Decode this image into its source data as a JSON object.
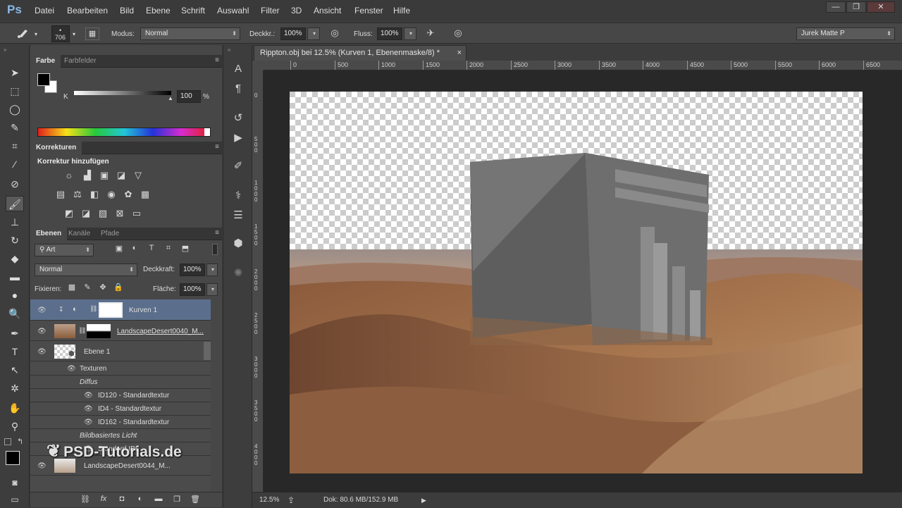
{
  "app": {
    "logo": "Ps"
  },
  "menu": [
    "Datei",
    "Bearbeiten",
    "Bild",
    "Ebene",
    "Schrift",
    "Auswahl",
    "Filter",
    "3D",
    "Ansicht",
    "Fenster",
    "Hilfe"
  ],
  "window_controls": {
    "minimize": "—",
    "restore": "❐",
    "close": "✕"
  },
  "options": {
    "brush_size": "706",
    "mode_label": "Modus:",
    "mode_value": "Normal",
    "opacity_label": "Deckkr.:",
    "opacity_value": "100%",
    "flow_label": "Fluss:",
    "flow_value": "100%",
    "workspace": "Jurek Matte P"
  },
  "tools": [
    "move-tool",
    "marquee-tool",
    "lasso-tool",
    "quick-select-tool",
    "crop-tool",
    "eyedropper-tool",
    "healing-tool",
    "brush-tool",
    "stamp-tool",
    "history-brush-tool",
    "eraser-tool",
    "gradient-tool",
    "blur-tool",
    "dodge-tool",
    "pen-tool",
    "type-tool",
    "path-select-tool",
    "shape-tool",
    "hand-tool",
    "zoom-tool"
  ],
  "color_panel": {
    "tabs": [
      "Farbe",
      "Farbfelder"
    ],
    "channel_label": "K",
    "value": "100",
    "unit": "%"
  },
  "adjustments_panel": {
    "tab": "Korrekturen",
    "title": "Korrektur hinzufügen"
  },
  "layers_panel": {
    "tabs": [
      "Ebenen",
      "Kanäle",
      "Pfade"
    ],
    "filter_kind": "Art",
    "blend_mode": "Normal",
    "opacity_label": "Deckkraft:",
    "opacity_value": "100%",
    "lock_label": "Fixieren:",
    "fill_label": "Fläche:",
    "fill_value": "100%",
    "layers": [
      {
        "name": "Kurven 1",
        "selected": true
      },
      {
        "name": "LandscapeDesert0040_M..."
      },
      {
        "name": "Ebene 1"
      },
      {
        "name": "Texturen"
      },
      {
        "name": "Diffus"
      },
      {
        "name": "ID120 - Standardtextur"
      },
      {
        "name": "ID4 - Standardtextur"
      },
      {
        "name": "ID162 - Standardtextur"
      },
      {
        "name": "Bildbasiertes Licht"
      },
      {
        "name": "Standard IBL"
      },
      {
        "name": "LandscapeDesert0044_M..."
      }
    ]
  },
  "document": {
    "tab_title": "Rippton.obj bei 12.5% (Kurven 1, Ebenenmaske/8) *",
    "close": "×",
    "ruler_h": [
      "0",
      "500",
      "1000",
      "1500",
      "2000",
      "2500",
      "3000",
      "3500",
      "4000",
      "4500",
      "5000",
      "5500",
      "6000",
      "6500"
    ],
    "ruler_v": [
      "0",
      "5 0 0",
      "1 0 0 0",
      "1 5 0 0",
      "2 0 0 0",
      "2 5 0 0",
      "3 0 0 0",
      "3 5 0 0",
      "4 0 0 0"
    ]
  },
  "status": {
    "zoom": "12.5%",
    "doc_info": "Dok: 80.6 MB/152.9 MB"
  },
  "watermark": "PSD-Tutorials.de"
}
